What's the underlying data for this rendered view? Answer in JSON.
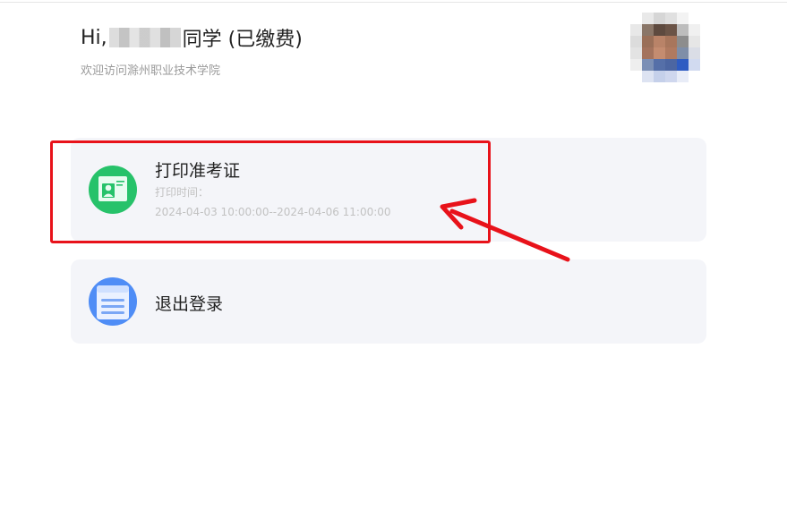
{
  "header": {
    "greeting_prefix": "Hi,",
    "greeting_suffix": "同学 (已缴费)",
    "subtitle": "欢迎访问滁州职业技术学院"
  },
  "cards": {
    "print": {
      "title": "打印准考证",
      "time_label": "打印时间：",
      "time_range": "2024-04-03 10:00:00--2024-04-06 11:00:00",
      "icon": "admission-ticket-icon"
    },
    "logout": {
      "title": "退出登录",
      "icon": "document-list-icon"
    }
  },
  "colors": {
    "print_icon": "#27c26a",
    "logout_icon": "#4f8df6",
    "card_bg": "#f4f5f9",
    "annotation": "#e8121a"
  }
}
